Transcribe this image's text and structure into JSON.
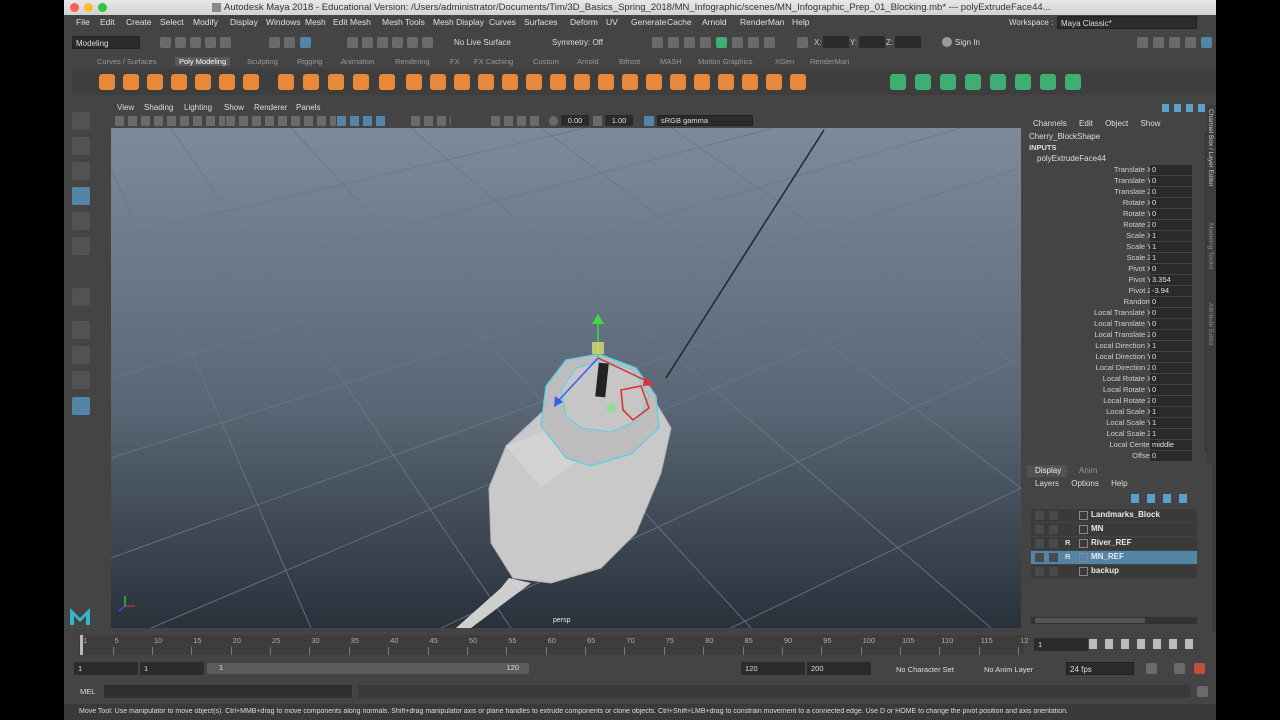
{
  "window": {
    "title": "Autodesk Maya 2018 - Educational Version: /Users/administrator/Documents/Tim/3D_Basics_Spring_2018/MN_Infographic/scenes/MN_Infographic_Prep_01_Blocking.mb*   ---   polyExtrudeFace44..."
  },
  "menu": [
    "File",
    "Edit",
    "Create",
    "Select",
    "Modify",
    "Display",
    "Windows",
    "Mesh",
    "Edit Mesh",
    "Mesh Tools",
    "Mesh Display",
    "Curves",
    "Surfaces",
    "Deform",
    "UV",
    "Generate",
    "Cache",
    "Arnold",
    "RenderMan",
    "Help"
  ],
  "workspace": {
    "label": "Workspace :",
    "value": "Maya Classic*"
  },
  "status": {
    "mode": "Modeling",
    "live_surface": "No Live Surface",
    "symmetry": "Symmetry: Off",
    "x_label": "X:",
    "y_label": "Y:",
    "z_label": "Z:",
    "sign_in": "Sign In"
  },
  "shelf_tabs": [
    "Curves / Surfaces",
    "Poly Modeling",
    "Sculpting",
    "Rigging",
    "Animation",
    "Rendering",
    "FX",
    "FX Caching",
    "Custom",
    "Arnold",
    "Bifrost",
    "MASH",
    "Motion Graphics",
    "XGen",
    "RenderMan"
  ],
  "shelf_active": "Poly Modeling",
  "viewport": {
    "menu": [
      "View",
      "Shading",
      "Lighting",
      "Show",
      "Renderer",
      "Panels"
    ],
    "exposure": "0.00",
    "gamma": "1.00",
    "color_space": "sRGB gamma",
    "camera_label": "persp"
  },
  "channel_box": {
    "menu": [
      "Channels",
      "Edit",
      "Object",
      "Show"
    ],
    "object_name": "Cherry_BlockShape",
    "inputs_label": "INPUTS",
    "node_name": "polyExtrudeFace44",
    "attributes": [
      {
        "label": "Translate X",
        "value": "0"
      },
      {
        "label": "Translate Y",
        "value": "0"
      },
      {
        "label": "Translate Z",
        "value": "0"
      },
      {
        "label": "Rotate X",
        "value": "0"
      },
      {
        "label": "Rotate Y",
        "value": "0"
      },
      {
        "label": "Rotate Z",
        "value": "0"
      },
      {
        "label": "Scale X",
        "value": "1"
      },
      {
        "label": "Scale Y",
        "value": "1"
      },
      {
        "label": "Scale Z",
        "value": "1"
      },
      {
        "label": "Pivot X",
        "value": "0"
      },
      {
        "label": "Pivot Y",
        "value": "3.354"
      },
      {
        "label": "Pivot Z",
        "value": "-3.94"
      },
      {
        "label": "Random",
        "value": "0"
      },
      {
        "label": "Local Translate X",
        "value": "0"
      },
      {
        "label": "Local Translate Y",
        "value": "0"
      },
      {
        "label": "Local Translate Z",
        "value": "0"
      },
      {
        "label": "Local Direction X",
        "value": "1"
      },
      {
        "label": "Local Direction Y",
        "value": "0"
      },
      {
        "label": "Local Direction Z",
        "value": "0"
      },
      {
        "label": "Local Rotate X",
        "value": "0"
      },
      {
        "label": "Local Rotate Y",
        "value": "0"
      },
      {
        "label": "Local Rotate Z",
        "value": "0"
      },
      {
        "label": "Local Scale X",
        "value": "1"
      },
      {
        "label": "Local Scale Y",
        "value": "1"
      },
      {
        "label": "Local Scale Z",
        "value": "1"
      },
      {
        "label": "Local Center",
        "value": "middle"
      },
      {
        "label": "Offset",
        "value": "0"
      }
    ]
  },
  "side_tabs": [
    "Channel Box / Layer Editor",
    "Modeling Toolkit",
    "Attribute Editor"
  ],
  "layer_editor": {
    "tabs": [
      "Display",
      "Anim"
    ],
    "menu": [
      "Layers",
      "Options",
      "Help"
    ],
    "layers": [
      {
        "flag": "",
        "name": "Landmarks_Block",
        "selected": false
      },
      {
        "flag": "",
        "name": "MN",
        "selected": false
      },
      {
        "flag": "R",
        "name": "River_REF",
        "selected": false
      },
      {
        "flag": "R",
        "name": "MN_REF",
        "selected": true
      },
      {
        "flag": "",
        "name": "backup",
        "selected": false
      }
    ]
  },
  "timeline": {
    "ticks": [
      "1",
      "5",
      "10",
      "15",
      "20",
      "25",
      "30",
      "35",
      "40",
      "45",
      "50",
      "55",
      "60",
      "65",
      "70",
      "75",
      "80",
      "85",
      "90",
      "95",
      "100",
      "105",
      "110",
      "115",
      "12"
    ],
    "current_frame": "1"
  },
  "range": {
    "start": "1",
    "playback_start": "1",
    "slider_start": "1",
    "slider_end": "120",
    "playback_end": "120",
    "end": "200",
    "character_set": "No Character Set",
    "anim_layer": "No Anim Layer",
    "fps": "24 fps"
  },
  "command_line": {
    "label": "MEL"
  },
  "help_line": "Move Tool: Use manipulator to move object(s). Ctrl+MMB+drag to move components along normals. Shift+drag manipulator axis or plane handles to extrude components or clone objects. Ctrl+Shift+LMB+drag to constrain movement to a connected edge. Use D or HOME to change the pivot position and axis orientation.",
  "colors": {
    "accent": "#5285a6",
    "shelf_orange": "#e8893a",
    "shelf_green": "#3fae72",
    "selection_cyan": "#5ad0e8",
    "face_red": "#e03030"
  }
}
